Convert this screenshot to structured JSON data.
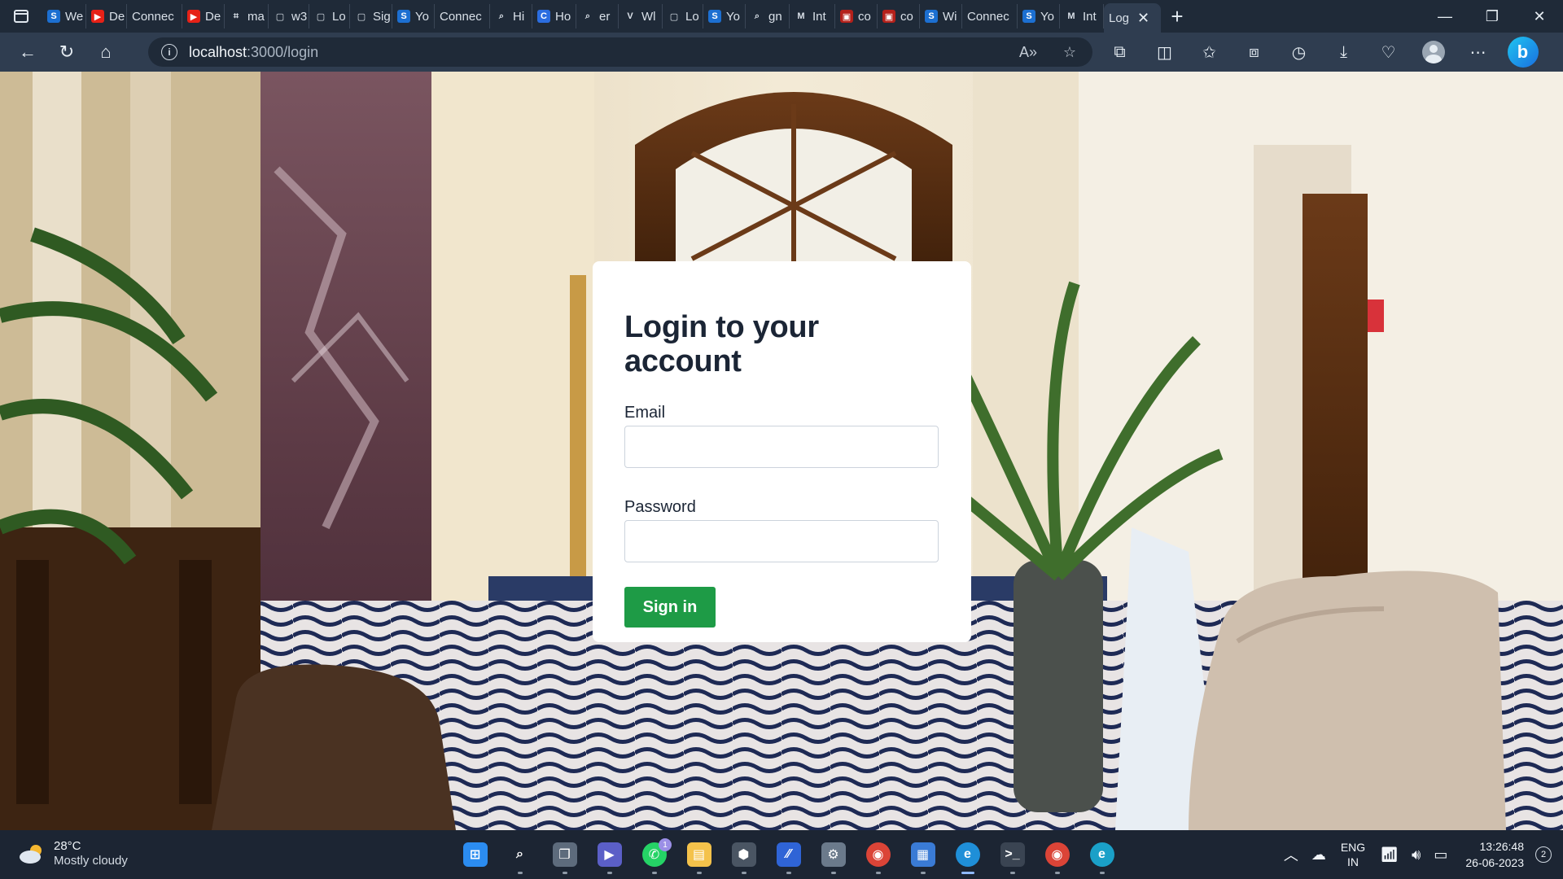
{
  "browser": {
    "tabs": [
      {
        "label": "We",
        "icon": "s-icon",
        "color": "#1c6fd1",
        "glyph": "S"
      },
      {
        "label": "De",
        "icon": "youtube-icon",
        "color": "#e62117",
        "glyph": "▶"
      },
      {
        "label": "Connec",
        "icon": "",
        "color": "",
        "glyph": ""
      },
      {
        "label": "De",
        "icon": "youtube-icon",
        "color": "#e62117",
        "glyph": "▶"
      },
      {
        "label": "ma",
        "icon": "page-icon",
        "color": "",
        "glyph": "⌗"
      },
      {
        "label": "w3",
        "icon": "document-icon",
        "color": "",
        "glyph": "▢"
      },
      {
        "label": "Lo",
        "icon": "document-icon",
        "color": "",
        "glyph": "▢"
      },
      {
        "label": "Sig",
        "icon": "document-icon",
        "color": "",
        "glyph": "▢"
      },
      {
        "label": "Yo",
        "icon": "s-icon",
        "color": "#1c6fd1",
        "glyph": "S"
      },
      {
        "label": "Connec",
        "icon": "",
        "color": "",
        "glyph": ""
      },
      {
        "label": "Hi",
        "icon": "search-icon",
        "color": "",
        "glyph": "⌕"
      },
      {
        "label": "Ho",
        "icon": "c-icon",
        "color": "#2b6de0",
        "glyph": "C"
      },
      {
        "label": "er",
        "icon": "search-icon",
        "color": "",
        "glyph": "⌕"
      },
      {
        "label": "Wl",
        "icon": "v-icon",
        "color": "",
        "glyph": "V"
      },
      {
        "label": "Lo",
        "icon": "document-icon",
        "color": "",
        "glyph": "▢"
      },
      {
        "label": "Yo",
        "icon": "s-icon",
        "color": "#1c6fd1",
        "glyph": "S"
      },
      {
        "label": "gn",
        "icon": "search-icon",
        "color": "",
        "glyph": "⌕"
      },
      {
        "label": "Int",
        "icon": "gmail-icon",
        "color": "",
        "glyph": "M"
      },
      {
        "label": "co",
        "icon": "pdf-icon",
        "color": "#b4201a",
        "glyph": "▣"
      },
      {
        "label": "co",
        "icon": "pdf-icon",
        "color": "#b4201a",
        "glyph": "▣"
      },
      {
        "label": "Wi",
        "icon": "s-icon",
        "color": "#1c6fd1",
        "glyph": "S"
      },
      {
        "label": "Connec",
        "icon": "",
        "color": "",
        "glyph": ""
      },
      {
        "label": "Yo",
        "icon": "s-icon",
        "color": "#1c6fd1",
        "glyph": "S"
      },
      {
        "label": "Int",
        "icon": "gmail-icon",
        "color": "",
        "glyph": "M"
      },
      {
        "label": "Log",
        "icon": "",
        "color": "",
        "glyph": "",
        "active": true
      }
    ],
    "url_host": "localhost",
    "url_path": ":3000/login"
  },
  "login": {
    "title": "Login to your account",
    "email_label": "Email",
    "email_value": "",
    "password_label": "Password",
    "password_value": "",
    "submit_label": "Sign in",
    "accent_color": "#1e9b46"
  },
  "taskbar": {
    "weather_temp": "28°C",
    "weather_condition": "Mostly cloudy",
    "apps": [
      {
        "name": "start-icon"
      },
      {
        "name": "search-icon"
      },
      {
        "name": "task-view-icon"
      },
      {
        "name": "meet-icon"
      },
      {
        "name": "whatsapp-icon",
        "badge": "1"
      },
      {
        "name": "file-explorer-icon"
      },
      {
        "name": "app-icon"
      },
      {
        "name": "editor-icon"
      },
      {
        "name": "settings-icon"
      },
      {
        "name": "chrome-icon"
      },
      {
        "name": "store-icon"
      },
      {
        "name": "edge-icon",
        "active": true
      },
      {
        "name": "terminal-icon"
      },
      {
        "name": "chrome-profile-icon"
      },
      {
        "name": "edge-dev-icon"
      }
    ],
    "lang_line1": "ENG",
    "lang_line2": "IN",
    "time": "13:26:48",
    "date": "26-06-2023",
    "notifications": "2"
  }
}
